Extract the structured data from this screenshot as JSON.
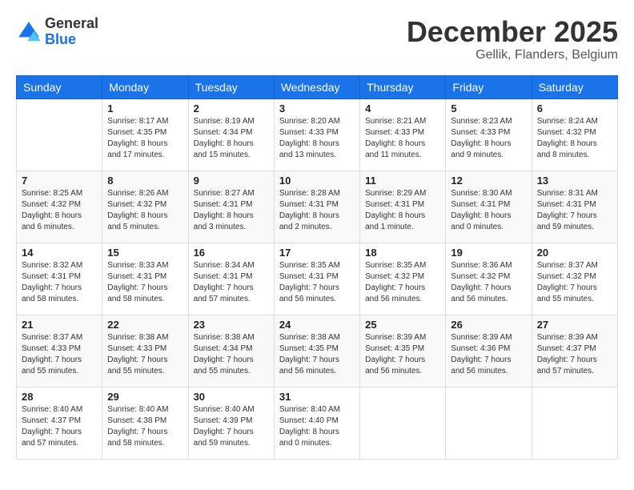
{
  "header": {
    "logo_general": "General",
    "logo_blue": "Blue",
    "month_title": "December 2025",
    "location": "Gellik, Flanders, Belgium"
  },
  "weekdays": [
    "Sunday",
    "Monday",
    "Tuesday",
    "Wednesday",
    "Thursday",
    "Friday",
    "Saturday"
  ],
  "weeks": [
    [
      {
        "day": "",
        "info": ""
      },
      {
        "day": "1",
        "info": "Sunrise: 8:17 AM\nSunset: 4:35 PM\nDaylight: 8 hours\nand 17 minutes."
      },
      {
        "day": "2",
        "info": "Sunrise: 8:19 AM\nSunset: 4:34 PM\nDaylight: 8 hours\nand 15 minutes."
      },
      {
        "day": "3",
        "info": "Sunrise: 8:20 AM\nSunset: 4:33 PM\nDaylight: 8 hours\nand 13 minutes."
      },
      {
        "day": "4",
        "info": "Sunrise: 8:21 AM\nSunset: 4:33 PM\nDaylight: 8 hours\nand 11 minutes."
      },
      {
        "day": "5",
        "info": "Sunrise: 8:23 AM\nSunset: 4:33 PM\nDaylight: 8 hours\nand 9 minutes."
      },
      {
        "day": "6",
        "info": "Sunrise: 8:24 AM\nSunset: 4:32 PM\nDaylight: 8 hours\nand 8 minutes."
      }
    ],
    [
      {
        "day": "7",
        "info": "Sunrise: 8:25 AM\nSunset: 4:32 PM\nDaylight: 8 hours\nand 6 minutes."
      },
      {
        "day": "8",
        "info": "Sunrise: 8:26 AM\nSunset: 4:32 PM\nDaylight: 8 hours\nand 5 minutes."
      },
      {
        "day": "9",
        "info": "Sunrise: 8:27 AM\nSunset: 4:31 PM\nDaylight: 8 hours\nand 3 minutes."
      },
      {
        "day": "10",
        "info": "Sunrise: 8:28 AM\nSunset: 4:31 PM\nDaylight: 8 hours\nand 2 minutes."
      },
      {
        "day": "11",
        "info": "Sunrise: 8:29 AM\nSunset: 4:31 PM\nDaylight: 8 hours\nand 1 minute."
      },
      {
        "day": "12",
        "info": "Sunrise: 8:30 AM\nSunset: 4:31 PM\nDaylight: 8 hours\nand 0 minutes."
      },
      {
        "day": "13",
        "info": "Sunrise: 8:31 AM\nSunset: 4:31 PM\nDaylight: 7 hours\nand 59 minutes."
      }
    ],
    [
      {
        "day": "14",
        "info": "Sunrise: 8:32 AM\nSunset: 4:31 PM\nDaylight: 7 hours\nand 58 minutes."
      },
      {
        "day": "15",
        "info": "Sunrise: 8:33 AM\nSunset: 4:31 PM\nDaylight: 7 hours\nand 58 minutes."
      },
      {
        "day": "16",
        "info": "Sunrise: 8:34 AM\nSunset: 4:31 PM\nDaylight: 7 hours\nand 57 minutes."
      },
      {
        "day": "17",
        "info": "Sunrise: 8:35 AM\nSunset: 4:31 PM\nDaylight: 7 hours\nand 56 minutes."
      },
      {
        "day": "18",
        "info": "Sunrise: 8:35 AM\nSunset: 4:32 PM\nDaylight: 7 hours\nand 56 minutes."
      },
      {
        "day": "19",
        "info": "Sunrise: 8:36 AM\nSunset: 4:32 PM\nDaylight: 7 hours\nand 56 minutes."
      },
      {
        "day": "20",
        "info": "Sunrise: 8:37 AM\nSunset: 4:32 PM\nDaylight: 7 hours\nand 55 minutes."
      }
    ],
    [
      {
        "day": "21",
        "info": "Sunrise: 8:37 AM\nSunset: 4:33 PM\nDaylight: 7 hours\nand 55 minutes."
      },
      {
        "day": "22",
        "info": "Sunrise: 8:38 AM\nSunset: 4:33 PM\nDaylight: 7 hours\nand 55 minutes."
      },
      {
        "day": "23",
        "info": "Sunrise: 8:38 AM\nSunset: 4:34 PM\nDaylight: 7 hours\nand 55 minutes."
      },
      {
        "day": "24",
        "info": "Sunrise: 8:38 AM\nSunset: 4:35 PM\nDaylight: 7 hours\nand 56 minutes."
      },
      {
        "day": "25",
        "info": "Sunrise: 8:39 AM\nSunset: 4:35 PM\nDaylight: 7 hours\nand 56 minutes."
      },
      {
        "day": "26",
        "info": "Sunrise: 8:39 AM\nSunset: 4:36 PM\nDaylight: 7 hours\nand 56 minutes."
      },
      {
        "day": "27",
        "info": "Sunrise: 8:39 AM\nSunset: 4:37 PM\nDaylight: 7 hours\nand 57 minutes."
      }
    ],
    [
      {
        "day": "28",
        "info": "Sunrise: 8:40 AM\nSunset: 4:37 PM\nDaylight: 7 hours\nand 57 minutes."
      },
      {
        "day": "29",
        "info": "Sunrise: 8:40 AM\nSunset: 4:38 PM\nDaylight: 7 hours\nand 58 minutes."
      },
      {
        "day": "30",
        "info": "Sunrise: 8:40 AM\nSunset: 4:39 PM\nDaylight: 7 hours\nand 59 minutes."
      },
      {
        "day": "31",
        "info": "Sunrise: 8:40 AM\nSunset: 4:40 PM\nDaylight: 8 hours\nand 0 minutes."
      },
      {
        "day": "",
        "info": ""
      },
      {
        "day": "",
        "info": ""
      },
      {
        "day": "",
        "info": ""
      }
    ]
  ]
}
